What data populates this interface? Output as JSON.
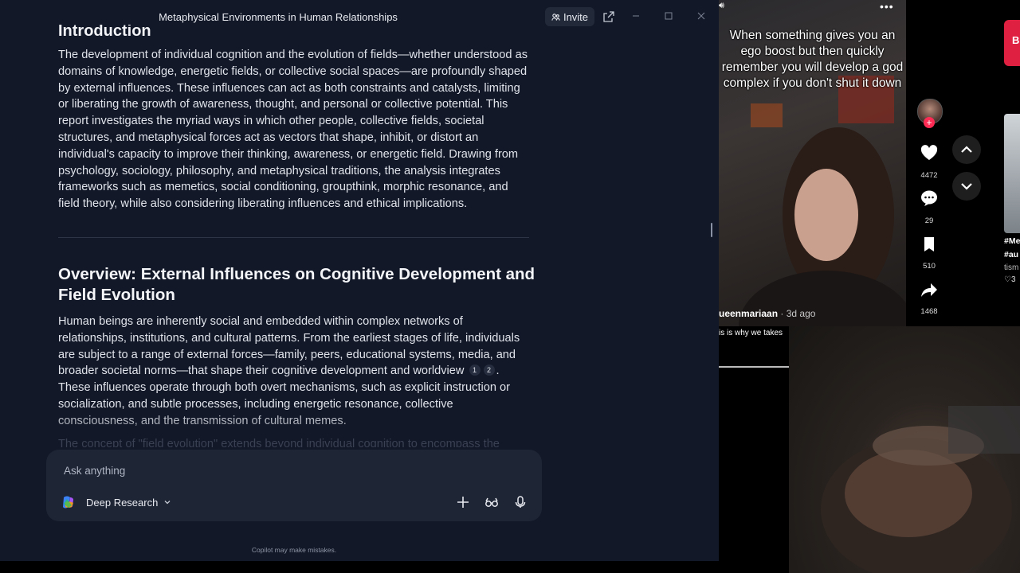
{
  "window": {
    "title": "Metaphysical Environments in Human Relationships",
    "invite_label": "Invite"
  },
  "document": {
    "intro_heading": "Introduction",
    "intro_paragraph": "The development of individual cognition and the evolution of fields—whether understood as domains of knowledge, energetic fields, or collective social spaces—are profoundly shaped by external influences. These influences can act as both constraints and catalysts, limiting or liberating the growth of awareness, thought, and personal or collective potential. This report investigates the myriad ways in which other people, collective fields, societal structures, and metaphysical forces act as vectors that shape, inhibit, or distort an individual's capacity to improve their thinking, awareness, or energetic field. Drawing from psychology, sociology, philosophy, and metaphysical traditions, the analysis integrates frameworks such as memetics, social conditioning, groupthink, morphic resonance, and field theory, while also considering liberating influences and ethical implications.",
    "overview_heading": "Overview: External Influences on Cognitive Development and Field Evolution",
    "overview_paragraph_a": "Human beings are inherently social and embedded within complex networks of relationships, institutions, and cultural patterns. From the earliest stages of life, individuals are subject to a range of external forces—family, peers, educational systems, media, and broader societal norms—that shape their cognitive development and worldview",
    "citation_1": "1",
    "citation_2": "2",
    "overview_paragraph_b": ". These influences operate through both overt mechanisms, such as explicit instruction or socialization, and subtle processes, including energetic resonance, collective consciousness, and the transmission of cultural memes.",
    "faded_line": "The concept of \"field evolution\" extends beyond individual cognition to encompass the"
  },
  "composer": {
    "placeholder": "Ask anything",
    "mode_label": "Deep Research"
  },
  "disclaimer": "Copilot may make mistakes.",
  "tiktok": {
    "caption": "When something gives you an ego boost but then quickly remember you will develop a god complex if you don't shut it down",
    "username": "ueenmariaan",
    "posted": " · 3d ago",
    "subtitle": "is is why we takes",
    "likes": "4472",
    "comments": "29",
    "saves": "510",
    "shares": "1468",
    "next_card_hashtags_1": "#Me",
    "next_card_hashtags_2": "#au",
    "next_card_text": "tism",
    "next_card_likes": "3",
    "next_card_badge": "B"
  },
  "colors": {
    "app_background": "#121828",
    "composer_background": "#1e2535",
    "tiktok_like_red": "#fe2c55"
  }
}
